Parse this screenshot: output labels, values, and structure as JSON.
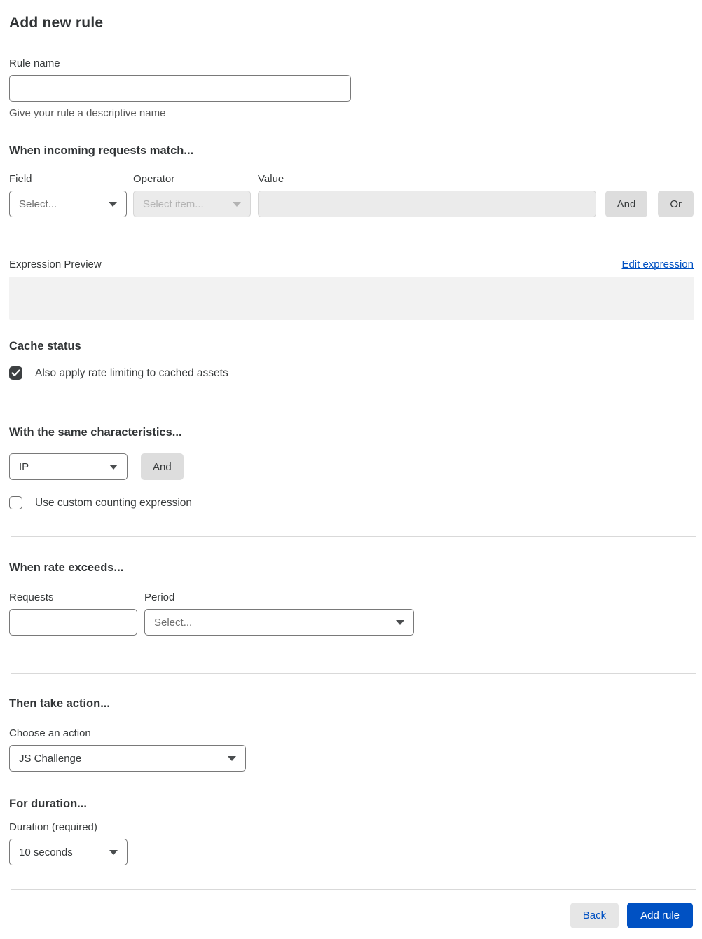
{
  "page": {
    "title": "Add new rule"
  },
  "rule_name": {
    "label": "Rule name",
    "value": "",
    "help": "Give your rule a descriptive name"
  },
  "match_section": {
    "heading": "When incoming requests match...",
    "field": {
      "label": "Field",
      "selected": "Select..."
    },
    "operator": {
      "label": "Operator",
      "selected": "Select item...",
      "disabled": true
    },
    "value": {
      "label": "Value",
      "value": "",
      "disabled": true
    },
    "and_button": "And",
    "or_button": "Or",
    "expression_preview_label": "Expression Preview",
    "edit_expression_link": "Edit expression",
    "expression_preview_value": ""
  },
  "cache_section": {
    "heading": "Cache status",
    "checkbox_label": "Also apply rate limiting to cached assets",
    "checkbox_checked": true
  },
  "characteristics_section": {
    "heading": "With the same characteristics...",
    "characteristic_select": {
      "selected": "IP"
    },
    "and_button": "And",
    "custom_counting": {
      "label": "Use custom counting expression",
      "checked": false
    }
  },
  "rate_section": {
    "heading": "When rate exceeds...",
    "requests": {
      "label": "Requests",
      "value": ""
    },
    "period": {
      "label": "Period",
      "selected": "Select..."
    }
  },
  "action_section": {
    "heading": "Then take action...",
    "action": {
      "label": "Choose an action",
      "selected": "JS Challenge"
    }
  },
  "duration_section": {
    "heading": "For duration...",
    "duration": {
      "label": "Duration (required)",
      "selected": "10 seconds"
    }
  },
  "footer": {
    "back_button": "Back",
    "add_rule_button": "Add rule"
  },
  "icons": {
    "dropdown_arrow": "chevron-down-icon",
    "checkmark": "checkmark-icon"
  },
  "colors": {
    "accent_blue": "#0051c3",
    "text_dark": "#36393a",
    "checkbox_checked_bg": "#3d4042",
    "disabled_bg": "#ebebeb",
    "preview_box_bg": "#f2f2f2",
    "secondary_button_bg": "#dddddd",
    "divider": "#d9d9d9"
  }
}
